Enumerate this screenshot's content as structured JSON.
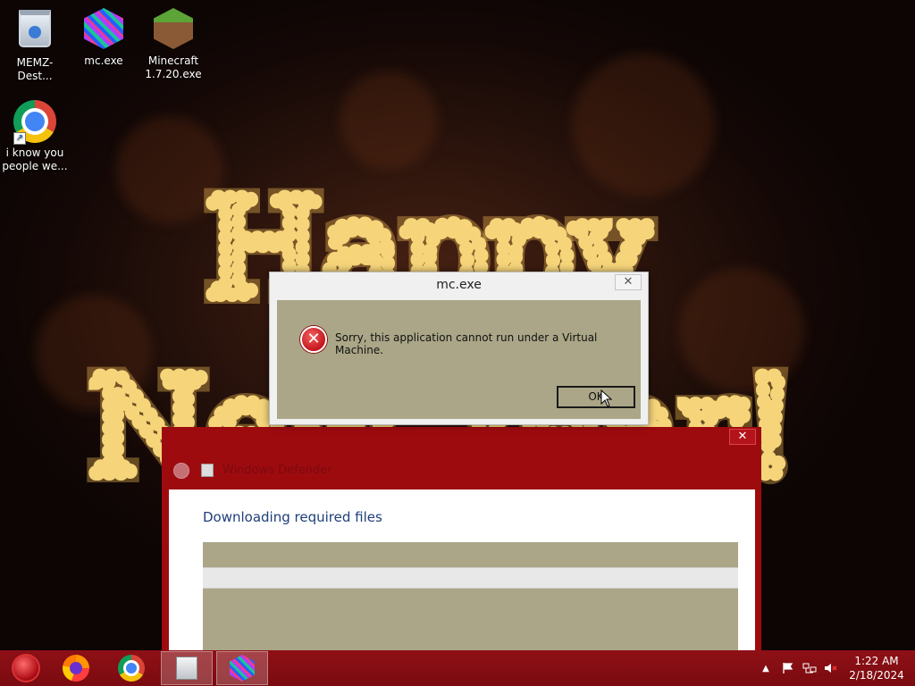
{
  "desktop": {
    "icons": [
      {
        "label": "MEMZ-Dest...",
        "icon": "recycle-bin-icon"
      },
      {
        "label": "mc.exe",
        "icon": "glitch-cube-icon"
      },
      {
        "label": "Minecraft 1.7.20.exe",
        "icon": "minecraft-grass-block-icon"
      },
      {
        "label": "i know you people we...",
        "icon": "chrome-icon"
      }
    ],
    "wallpaper_text": "Happy New Year!"
  },
  "dialog": {
    "title": "mc.exe",
    "close": "✕",
    "message": "Sorry, this application cannot run under a Virtual Machine.",
    "ok_label": "OK",
    "icon": "error-icon"
  },
  "installer": {
    "title": "Windows Defender",
    "close": "✕",
    "heading": "Downloading required files",
    "progress": 0
  },
  "taskbar": {
    "buttons": [
      {
        "name": "start",
        "icon": "start-orb-icon"
      },
      {
        "name": "firefox",
        "icon": "firefox-icon"
      },
      {
        "name": "chrome",
        "icon": "chrome-icon"
      },
      {
        "name": "installer-window",
        "icon": "setup-icon",
        "active": true
      },
      {
        "name": "mc-exe-window",
        "icon": "glitch-cube-icon",
        "active": true
      }
    ],
    "tray": {
      "show_hidden": "▲",
      "time": "1:22 AM",
      "date": "2/18/2024"
    }
  },
  "colors": {
    "taskbar": "#8e1016",
    "installer_frame": "#9e0b0f",
    "dialog_body": "#aaa687",
    "heading_blue": "#1e3e7a"
  }
}
